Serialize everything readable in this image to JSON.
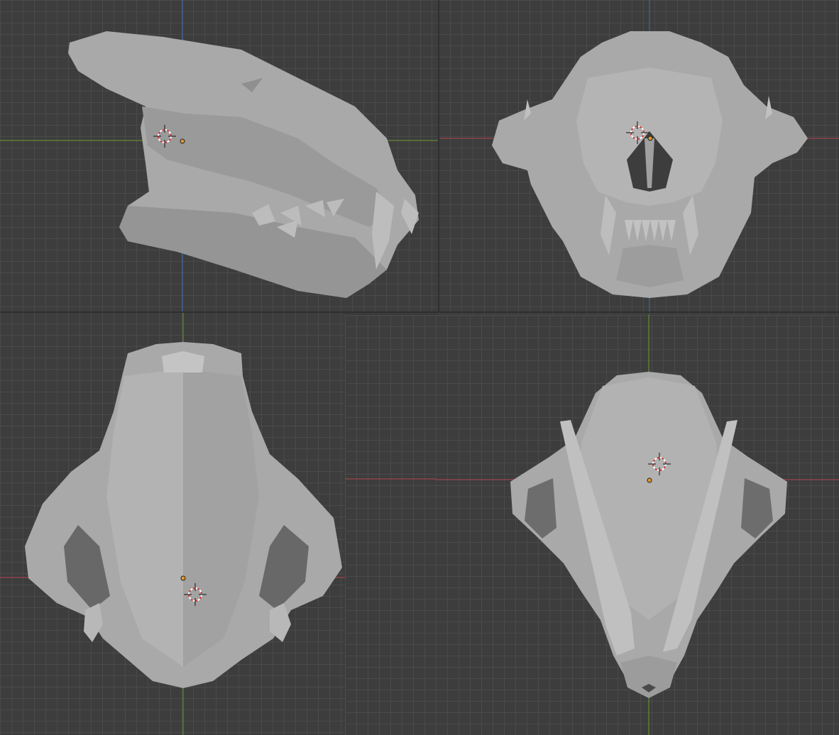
{
  "viewports": [
    {
      "id": "vp-tl",
      "view": "side",
      "mode": "object"
    },
    {
      "id": "vp-tr",
      "view": "front",
      "mode": "object"
    },
    {
      "id": "vp-bl",
      "view": "top",
      "mode": "object"
    },
    {
      "id": "vp-bm",
      "view": "empty",
      "mode": "object"
    },
    {
      "id": "vp-br",
      "view": "bottom",
      "mode": "object"
    }
  ],
  "colors": {
    "background": "#3d3d3d",
    "grid": "#4a4a4a",
    "axis_x": "#b5454f",
    "axis_y": "#6a9a2e",
    "axis_z": "#3f6fb5",
    "mesh": "#a9a9a9",
    "mesh_shadow": "#7e7e7e",
    "origin": "#e09a2b"
  },
  "icons": [
    "3d-cursor-icon",
    "object-origin-icon"
  ]
}
